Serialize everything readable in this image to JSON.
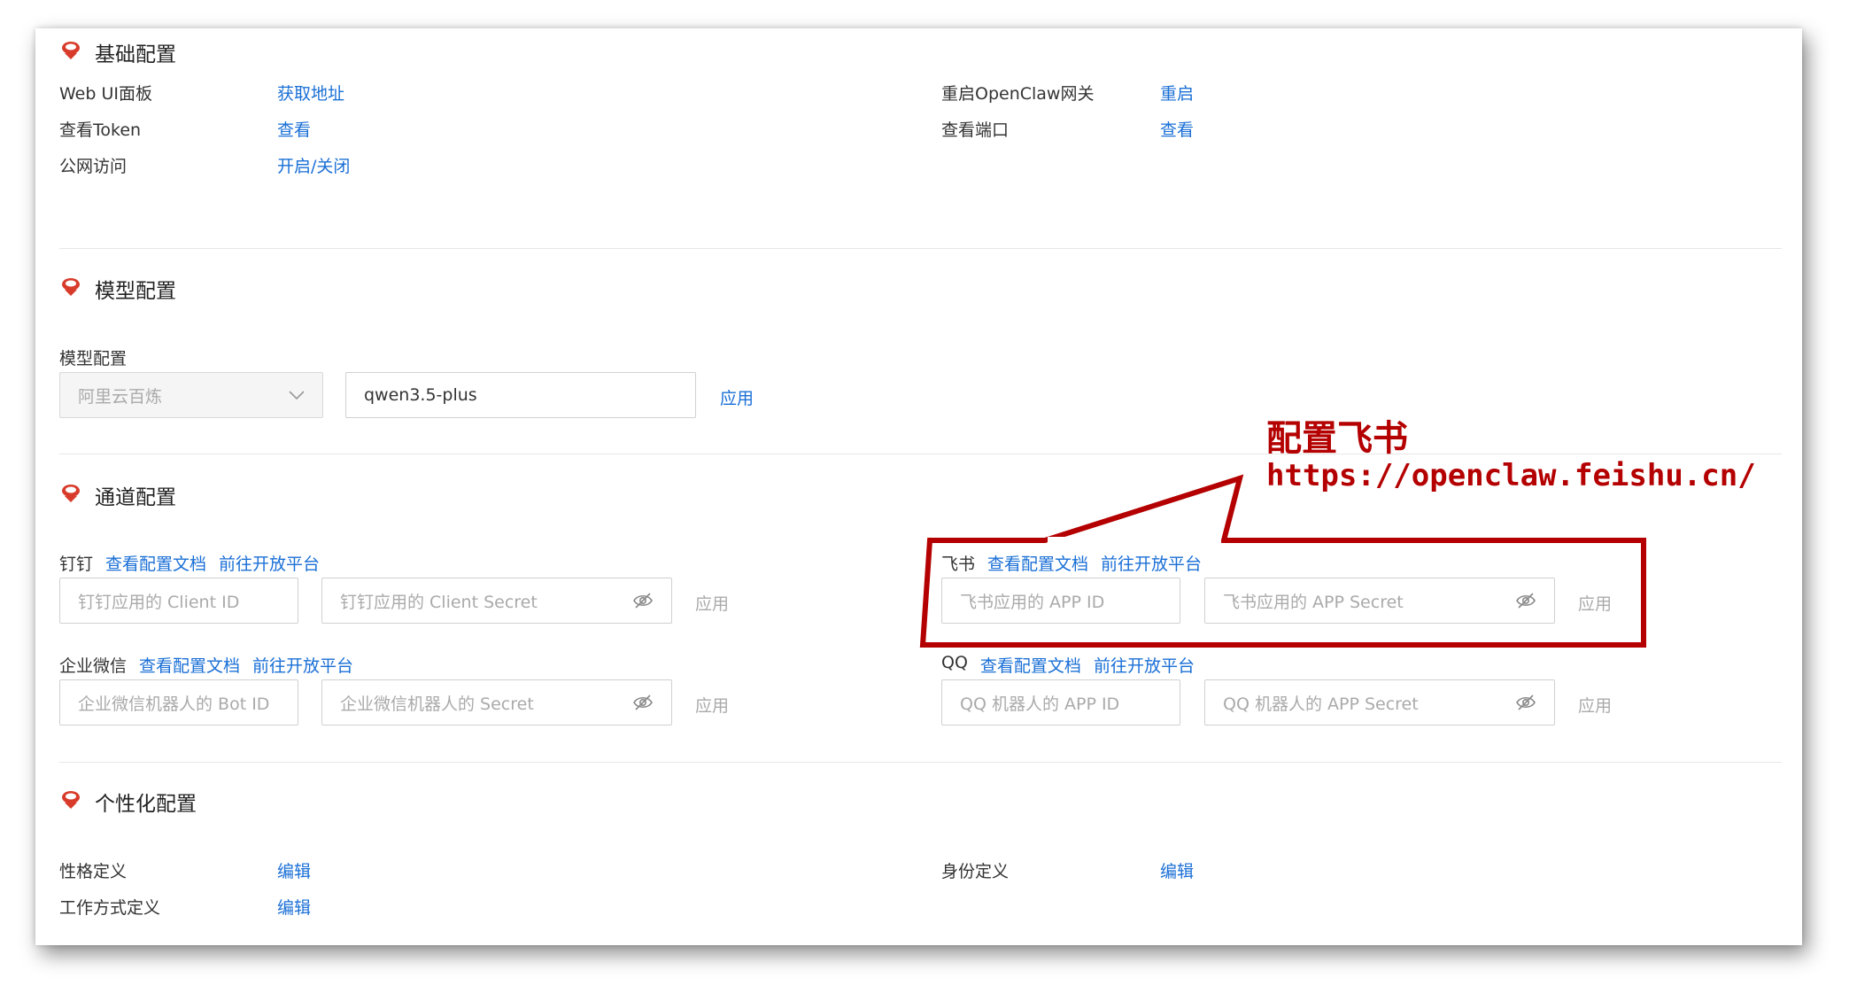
{
  "sections": {
    "basic": {
      "title": "基础配置",
      "rows": [
        {
          "label": "Web UI面板",
          "action": "获取地址"
        },
        {
          "label": "查看Token",
          "action": "查看"
        },
        {
          "label": "公网访问",
          "action": "开启/关闭"
        },
        {
          "label": "重启OpenClaw网关",
          "action": "重启"
        },
        {
          "label": "查看端口",
          "action": "查看"
        }
      ]
    },
    "model": {
      "title": "模型配置",
      "field_label": "模型配置",
      "provider_value": "阿里云百炼",
      "model_value": "qwen3.5-plus",
      "apply_label": "应用"
    },
    "channel": {
      "title": "通道配置",
      "view_doc_label": "查看配置文档",
      "open_platform_label": "前往开放平台",
      "apply_label": "应用",
      "items": [
        {
          "name": "钉钉",
          "id_placeholder": "钉钉应用的 Client ID",
          "secret_placeholder": "钉钉应用的 Client Secret"
        },
        {
          "name": "飞书",
          "id_placeholder": "飞书应用的 APP ID",
          "secret_placeholder": "飞书应用的 APP Secret"
        },
        {
          "name": "企业微信",
          "id_placeholder": "企业微信机器人的 Bot ID",
          "secret_placeholder": "企业微信机器人的 Secret"
        },
        {
          "name": "QQ",
          "id_placeholder": "QQ 机器人的 APP ID",
          "secret_placeholder": "QQ 机器人的 APP Secret"
        }
      ]
    },
    "personal": {
      "title": "个性化配置",
      "rows": [
        {
          "label": "性格定义",
          "action": "编辑"
        },
        {
          "label": "工作方式定义",
          "action": "编辑"
        },
        {
          "label": "身份定义",
          "action": "编辑"
        }
      ]
    }
  },
  "annotation": {
    "title": "配置飞书",
    "url": "https://openclaw.feishu.cn/"
  },
  "icons": {
    "section": "lobster-icon",
    "select": "chevron-down-icon",
    "secret": "eye-off-icon"
  },
  "colors": {
    "link": "#1a6fd6",
    "annotation": "#b40000",
    "icon": "#d83b2a"
  }
}
